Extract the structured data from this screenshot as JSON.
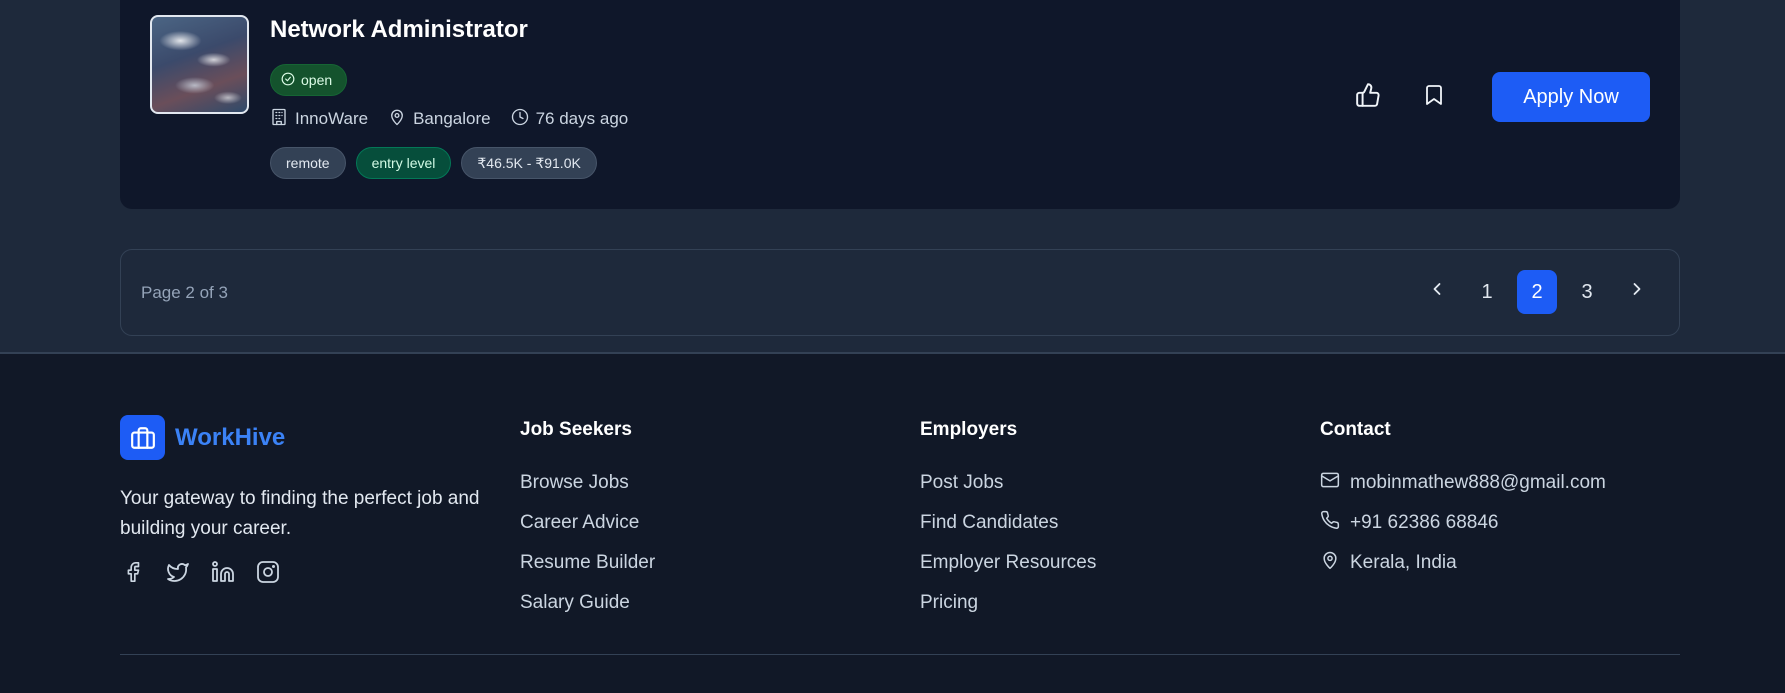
{
  "job": {
    "title": "Network Administrator",
    "status": "open",
    "company": "InnoWare",
    "location": "Bangalore",
    "posted": "76 days ago",
    "tags": [
      "remote",
      "entry level",
      "₹46.5K - ₹91.0K"
    ],
    "apply_label": "Apply Now"
  },
  "pagination": {
    "info": "Page 2 of 3",
    "pages": [
      "1",
      "2",
      "3"
    ],
    "current": "2"
  },
  "footer": {
    "brand": "WorkHive",
    "tagline": "Your gateway to finding the perfect job and building your career.",
    "columns": {
      "job_seekers": {
        "title": "Job Seekers",
        "links": [
          "Browse Jobs",
          "Career Advice",
          "Resume Builder",
          "Salary Guide"
        ]
      },
      "employers": {
        "title": "Employers",
        "links": [
          "Post Jobs",
          "Find Candidates",
          "Employer Resources",
          "Pricing"
        ]
      },
      "contact": {
        "title": "Contact",
        "email": "mobinmathew888@gmail.com",
        "phone": "+91 62386 68846",
        "address": "Kerala, India"
      }
    }
  },
  "colors": {
    "accent": "#1d5cf5",
    "brand_text": "#3b82f6",
    "card_bg": "#0f172a",
    "page_bg": "#1e293b",
    "status_open": "#14532d"
  },
  "icons": {
    "company": "building-icon",
    "location": "map-pin-icon",
    "time": "clock-icon",
    "like": "thumbs-up-icon",
    "save": "bookmark-icon",
    "brand": "briefcase-icon"
  }
}
